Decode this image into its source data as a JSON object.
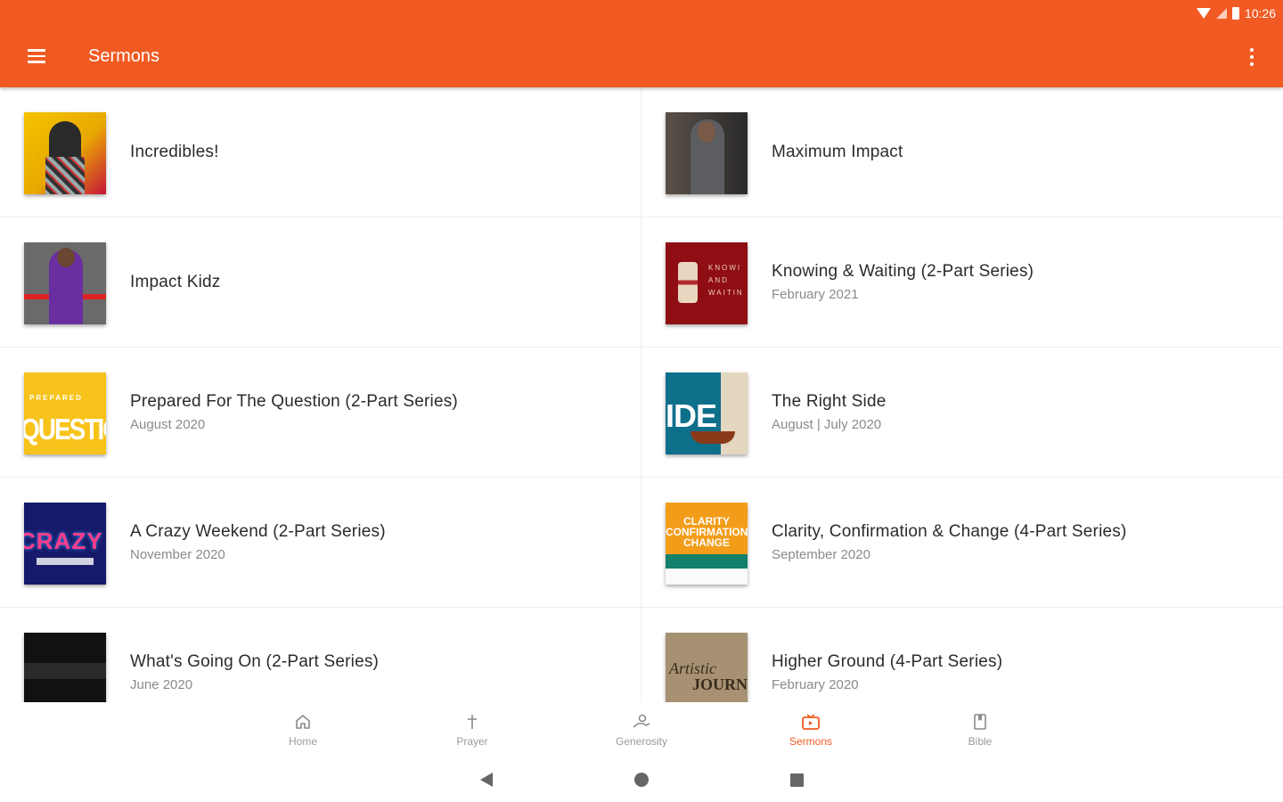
{
  "status": {
    "time": "10:26"
  },
  "appbar": {
    "title": "Sermons"
  },
  "sermons": [
    {
      "title": "Incredibles!",
      "subtitle": ""
    },
    {
      "title": "Maximum Impact",
      "subtitle": ""
    },
    {
      "title": "Impact Kidz",
      "subtitle": ""
    },
    {
      "title": "Knowing & Waiting (2-Part Series)",
      "subtitle": "February 2021"
    },
    {
      "title": "Prepared For The Question (2-Part Series)",
      "subtitle": "August 2020"
    },
    {
      "title": "The Right Side",
      "subtitle": "August | July 2020"
    },
    {
      "title": "A Crazy Weekend (2-Part Series)",
      "subtitle": "November 2020"
    },
    {
      "title": "Clarity, Confirmation & Change (4-Part Series)",
      "subtitle": "September 2020"
    },
    {
      "title": "What's Going On (2-Part Series)",
      "subtitle": "June 2020"
    },
    {
      "title": "Higher Ground (4-Part Series)",
      "subtitle": "February 2020"
    }
  ],
  "thumb_text": {
    "knowing": [
      "KNOWI",
      "AND",
      "WAITIN"
    ],
    "prepared_small": "PREPARED",
    "prepared_big": "QUESTION",
    "right": "IDE",
    "crazy": "CRAZY",
    "clarity": [
      "CLARITY",
      "CONFIRMATION",
      "CHANGE"
    ],
    "higher_a": "Artistic",
    "higher_j": "JOURNEY"
  },
  "bottom_nav": [
    {
      "label": "Home",
      "icon": "home-icon",
      "active": false
    },
    {
      "label": "Prayer",
      "icon": "cross-icon",
      "active": false
    },
    {
      "label": "Generosity",
      "icon": "giving-hand-icon",
      "active": false
    },
    {
      "label": "Sermons",
      "icon": "video-icon",
      "active": true
    },
    {
      "label": "Bible",
      "icon": "book-icon",
      "active": false
    }
  ],
  "colors": {
    "primary": "#f15a22",
    "text": "#2b2b2b",
    "subtext": "#8a8a8a"
  }
}
